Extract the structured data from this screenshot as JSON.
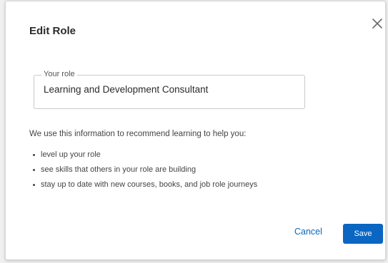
{
  "dialog": {
    "title": "Edit Role",
    "close_icon": "close-icon"
  },
  "role_field": {
    "label": "Your role",
    "value": "Learning and Development Consultant"
  },
  "info": {
    "intro": "We use this information to recommend learning to help you:",
    "bullets": [
      "level up your role",
      "see skills that others in your role are building",
      "stay up to date with new courses, books, and job role journeys"
    ]
  },
  "actions": {
    "cancel_label": "Cancel",
    "save_label": "Save"
  },
  "colors": {
    "accent": "#0a66c2",
    "text": "#2b2b2b",
    "border": "#c9c9c9"
  }
}
